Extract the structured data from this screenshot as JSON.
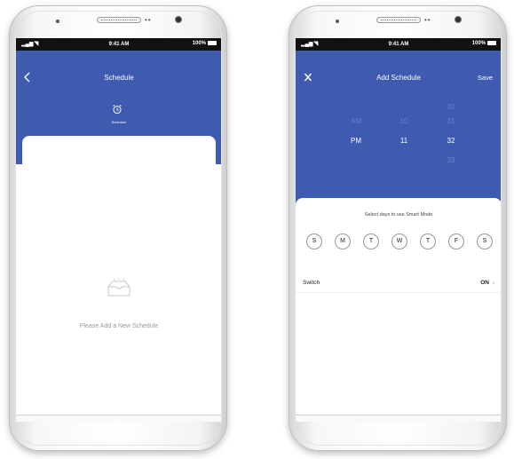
{
  "status_bar": {
    "time": "9:41 AM",
    "battery": "100%"
  },
  "schedule_screen": {
    "nav_title": "Schedule",
    "tab_label": "Schedule",
    "empty_message": "Please Add a New Schedule",
    "icons": {
      "back": "chevron-left-icon",
      "tab": "alarm-clock-icon",
      "empty": "empty-box-icon"
    }
  },
  "add_schedule_screen": {
    "nav_title": "Add Schedule",
    "save_label": "Save",
    "close_icon": "close-icon",
    "picker": {
      "period": [
        "",
        "AM",
        "PM"
      ],
      "hours": [
        "",
        "10",
        "11"
      ],
      "minutes": [
        "30",
        "31",
        "32",
        "33"
      ],
      "selected": {
        "period": "PM",
        "hour": "11",
        "minute": "32"
      }
    },
    "select_days_label": "Select days to use Smart Mode",
    "days": [
      "S",
      "M",
      "T",
      "W",
      "T",
      "F",
      "S"
    ],
    "switch_label": "Switch",
    "switch_value": "ON"
  },
  "colors": {
    "header_blue": "#3e5bb0",
    "status_bar": "#111111",
    "empty_text": "#999999"
  }
}
